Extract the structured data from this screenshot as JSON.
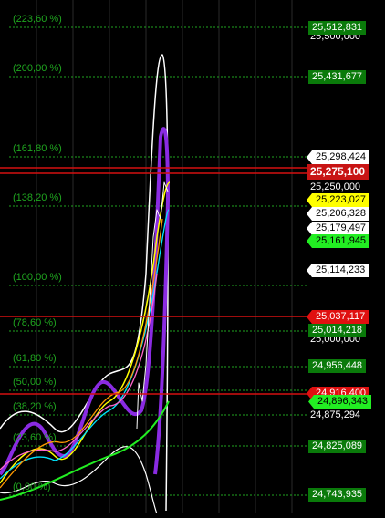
{
  "chart": {
    "fib_labels": [
      {
        "id": "fib-223",
        "text": "(223,60 %)"
      },
      {
        "id": "fib-200",
        "text": "(200,00 %)"
      },
      {
        "id": "fib-161",
        "text": "(161,80 %)"
      },
      {
        "id": "fib-138",
        "text": "(138,20 %)"
      },
      {
        "id": "fib-100",
        "text": "(100,00 %)"
      },
      {
        "id": "fib-78",
        "text": "(78,60 %)"
      },
      {
        "id": "fib-61",
        "text": "(61,80 %)"
      },
      {
        "id": "fib-50",
        "text": "(50,00 %)"
      },
      {
        "id": "fib-38",
        "text": "(38,20 %)"
      },
      {
        "id": "fib-23",
        "text": "(23,60 %)"
      },
      {
        "id": "fib-0",
        "text": "(0,00 %)"
      }
    ],
    "axis_labels": [
      {
        "id": "axis-25500",
        "text": "25,500,000"
      },
      {
        "id": "axis-25250",
        "text": "25,250,000"
      },
      {
        "id": "axis-25000",
        "text": "25,000,000"
      },
      {
        "id": "axis-24875",
        "text": "24,875,294"
      }
    ],
    "price_tags": [
      {
        "id": "tag-25512",
        "text": "25,512,831",
        "bg": "#0a7a0a",
        "fg": "#ffffff"
      },
      {
        "id": "tag-25431",
        "text": "25,431,677",
        "bg": "#0a7a0a",
        "fg": "#ffffff"
      },
      {
        "id": "tag-25298",
        "text": "25,298,424",
        "bg": "#ffffff",
        "fg": "#000000"
      },
      {
        "id": "tag-25275",
        "text": "25,275,100",
        "bg": "#c81414",
        "fg": "#ffffff"
      },
      {
        "id": "tag-25223",
        "text": "25,223,027",
        "bg": "#ffff00",
        "fg": "#000000"
      },
      {
        "id": "tag-25206",
        "text": "25,206,328",
        "bg": "#ffffff",
        "fg": "#000000"
      },
      {
        "id": "tag-25179",
        "text": "25,179,497",
        "bg": "#ffffff",
        "fg": "#000000"
      },
      {
        "id": "tag-25161",
        "text": "25,161,945",
        "bg": "#22ee22",
        "fg": "#000000"
      },
      {
        "id": "tag-25114",
        "text": "25,114,233",
        "bg": "#ffffff",
        "fg": "#000000"
      },
      {
        "id": "tag-25037",
        "text": "25,037,117",
        "bg": "#e01010",
        "fg": "#ffffff"
      },
      {
        "id": "tag-25014",
        "text": "25,014,218",
        "bg": "#0a7a0a",
        "fg": "#ffffff"
      },
      {
        "id": "tag-24956",
        "text": "24,956,448",
        "bg": "#0a7a0a",
        "fg": "#ffffff"
      },
      {
        "id": "tag-24916",
        "text": "24,916,400",
        "bg": "#e01010",
        "fg": "#ffffff"
      },
      {
        "id": "tag-24896",
        "text": "24,896,343",
        "bg": "#22ee22",
        "fg": "#000000"
      },
      {
        "id": "tag-24825",
        "text": "24,825,089",
        "bg": "#0a7a0a",
        "fg": "#ffffff"
      },
      {
        "id": "tag-24743",
        "text": "24,743,935",
        "bg": "#0a7a0a",
        "fg": "#ffffff"
      }
    ],
    "colors": {
      "background": "#000000",
      "fib_line": "#1fa51f",
      "grid": "#2a2a2a",
      "red_line": "#d41010",
      "purple": "#8a2be2",
      "white": "#ffffff",
      "green": "#22ee22",
      "yellow": "#ffff00",
      "cyan": "#00e5ff",
      "orange": "#ff9900",
      "pink": "#ff66cc"
    }
  }
}
